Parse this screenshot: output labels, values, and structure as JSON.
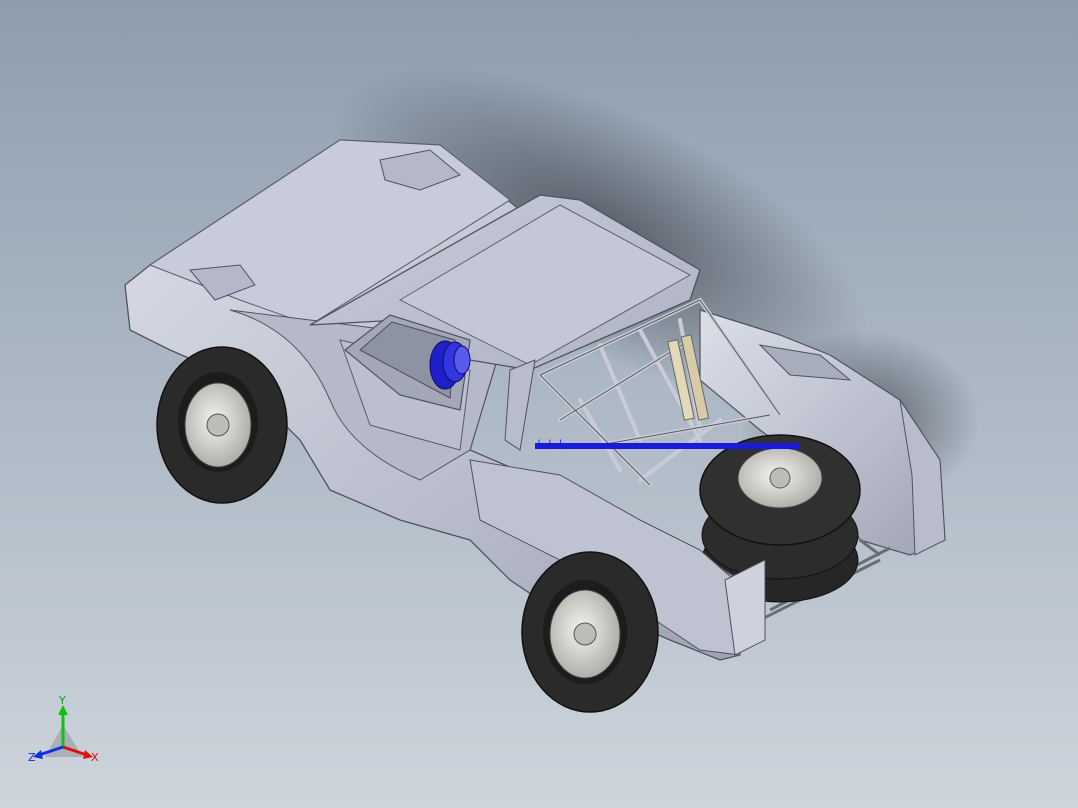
{
  "viewport": {
    "background_top": "#8e9dae",
    "background_bottom": "#cdd4dc"
  },
  "model": {
    "description_icon": "offroad-truck-model",
    "body_color": "#c5c9d6",
    "tire_color": "#2a2a2a",
    "wheel_color": "#d4d4d0",
    "highlight_color": "#1a1adb",
    "callout_text": "| | |"
  },
  "triad": {
    "x_label": "X",
    "y_label": "Y",
    "z_label": "Z",
    "x_color": "#e01010",
    "y_color": "#10c010",
    "z_color": "#1030e0"
  }
}
